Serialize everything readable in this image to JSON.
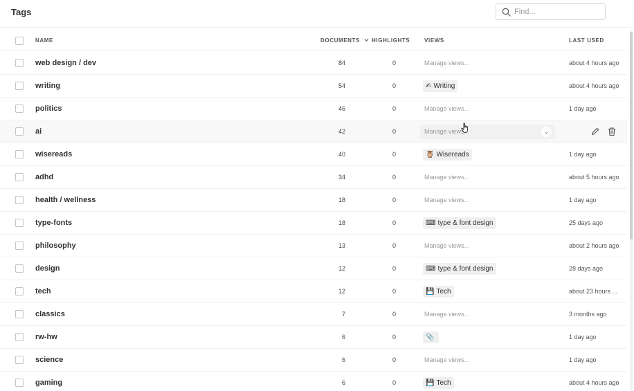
{
  "page": {
    "title": "Tags"
  },
  "search": {
    "placeholder": "Find..."
  },
  "columns": {
    "name": "NAME",
    "documents": "DOCUMENTS",
    "highlights": "HIGHLIGHTS",
    "views": "VIEWS",
    "last_used": "LAST USED"
  },
  "rows": [
    {
      "name": "web design / dev",
      "documents": "84",
      "highlights": "0",
      "view": "Manage views...",
      "view_emoji": "",
      "is_chip": false,
      "last_used": "about 4 hours ago"
    },
    {
      "name": "writing",
      "documents": "54",
      "highlights": "0",
      "view": "Writing",
      "view_emoji": "✍",
      "is_chip": true,
      "last_used": "about 4 hours ago"
    },
    {
      "name": "politics",
      "documents": "46",
      "highlights": "0",
      "view": "Manage views...",
      "view_emoji": "",
      "is_chip": false,
      "last_used": "1 day ago"
    },
    {
      "name": "ai",
      "documents": "42",
      "highlights": "0",
      "view": "Manage views...",
      "view_emoji": "",
      "is_chip": false,
      "last_used": "",
      "hovered": true
    },
    {
      "name": "wisereads",
      "documents": "40",
      "highlights": "0",
      "view": "Wisereads",
      "view_emoji": "🦉",
      "is_chip": true,
      "last_used": "1 day ago"
    },
    {
      "name": "adhd",
      "documents": "34",
      "highlights": "0",
      "view": "Manage views...",
      "view_emoji": "",
      "is_chip": false,
      "last_used": "about 5 hours ago"
    },
    {
      "name": "health / wellness",
      "documents": "18",
      "highlights": "0",
      "view": "Manage views...",
      "view_emoji": "",
      "is_chip": false,
      "last_used": "1 day ago"
    },
    {
      "name": "type-fonts",
      "documents": "18",
      "highlights": "0",
      "view": "type & font design",
      "view_emoji": "⌨",
      "is_chip": true,
      "last_used": "25 days ago"
    },
    {
      "name": "philosophy",
      "documents": "13",
      "highlights": "0",
      "view": "Manage views...",
      "view_emoji": "",
      "is_chip": false,
      "last_used": "about 2 hours ago"
    },
    {
      "name": "design",
      "documents": "12",
      "highlights": "0",
      "view": "type & font design",
      "view_emoji": "⌨",
      "is_chip": true,
      "last_used": "28 days ago"
    },
    {
      "name": "tech",
      "documents": "12",
      "highlights": "0",
      "view": "Tech",
      "view_emoji": "💾",
      "is_chip": true,
      "last_used": "about 23 hours ..."
    },
    {
      "name": "classics",
      "documents": "7",
      "highlights": "0",
      "view": "Manage views...",
      "view_emoji": "",
      "is_chip": false,
      "last_used": "3 months ago"
    },
    {
      "name": "rw-hw",
      "documents": "6",
      "highlights": "0",
      "view": "",
      "view_emoji": "📎",
      "is_chip": true,
      "last_used": "1 day ago"
    },
    {
      "name": "science",
      "documents": "6",
      "highlights": "0",
      "view": "Manage views...",
      "view_emoji": "",
      "is_chip": false,
      "last_used": "1 day ago"
    },
    {
      "name": "gaming",
      "documents": "6",
      "highlights": "0",
      "view": "Tech",
      "view_emoji": "💾",
      "is_chip": true,
      "last_used": "about 4 hours ago"
    }
  ],
  "icons": {
    "search": "search-icon",
    "sort": "chevron-down-icon",
    "edit": "pencil-icon",
    "delete": "trash-icon",
    "cursor": "hand-pointer-icon"
  }
}
